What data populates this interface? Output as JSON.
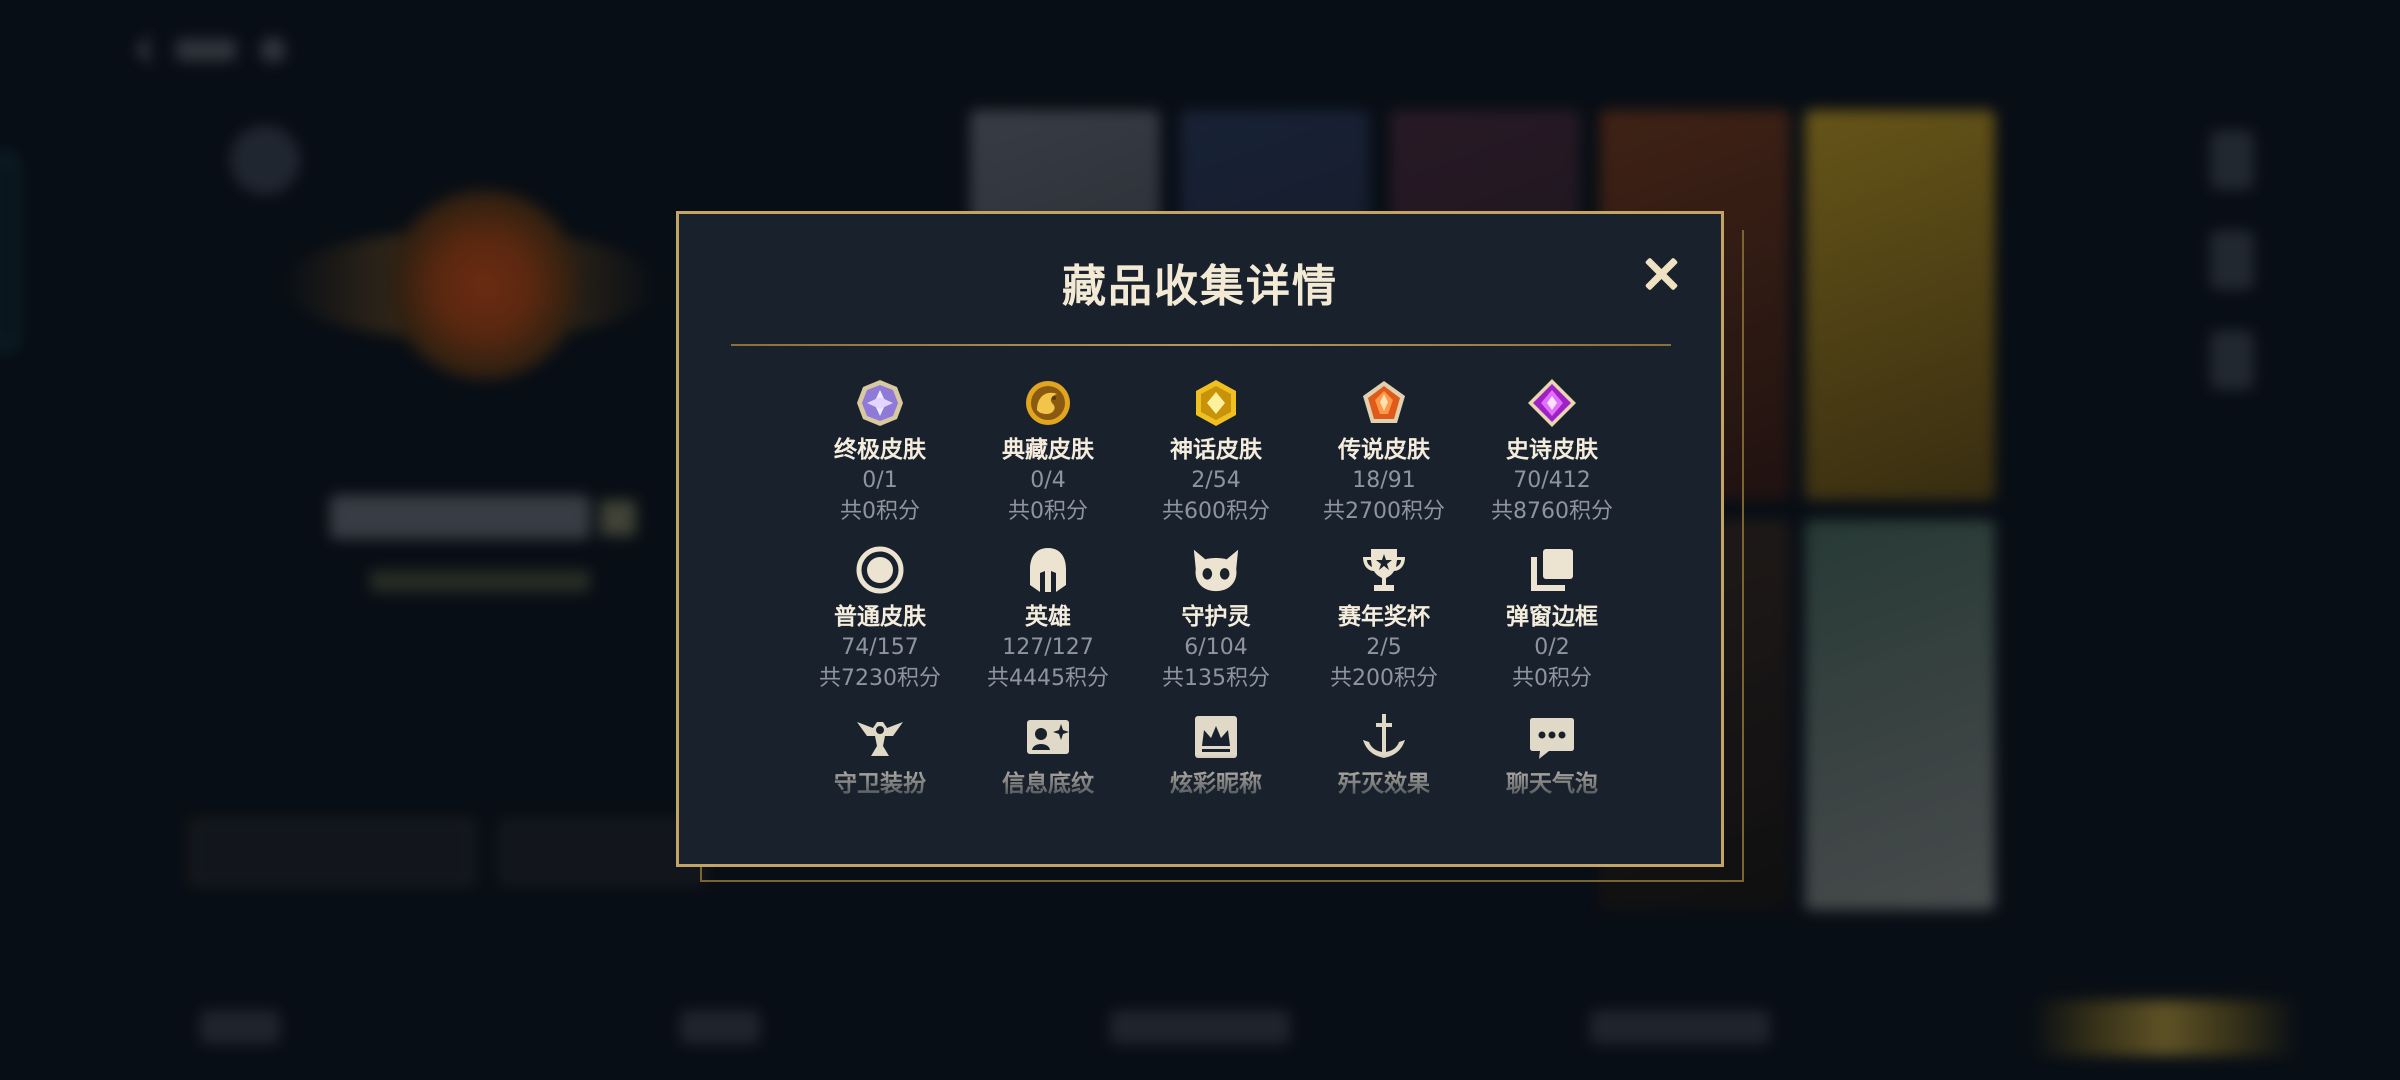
{
  "modal": {
    "title": "藏品收集详情"
  },
  "items": [
    {
      "label": "终极皮肤",
      "count": "0/1",
      "points": "共0积分",
      "icon": "ultimate-gem-icon"
    },
    {
      "label": "典藏皮肤",
      "count": "0/4",
      "points": "共0积分",
      "icon": "collector-dragon-icon"
    },
    {
      "label": "神话皮肤",
      "count": "2/54",
      "points": "共600积分",
      "icon": "mythic-gem-icon"
    },
    {
      "label": "传说皮肤",
      "count": "18/91",
      "points": "共2700积分",
      "icon": "legendary-gem-icon"
    },
    {
      "label": "史诗皮肤",
      "count": "70/412",
      "points": "共8760积分",
      "icon": "epic-gem-icon"
    },
    {
      "label": "普通皮肤",
      "count": "74/157",
      "points": "共7230积分",
      "icon": "common-ring-icon"
    },
    {
      "label": "英雄",
      "count": "127/127",
      "points": "共4445积分",
      "icon": "helmet-icon"
    },
    {
      "label": "守护灵",
      "count": "6/104",
      "points": "共135积分",
      "icon": "guardian-pet-icon"
    },
    {
      "label": "赛年奖杯",
      "count": "2/5",
      "points": "共200积分",
      "icon": "trophy-icon"
    },
    {
      "label": "弹窗边框",
      "count": "0/2",
      "points": "共0积分",
      "icon": "frame-icon"
    },
    {
      "label": "守卫装扮",
      "icon": "ward-icon"
    },
    {
      "label": "信息底纹",
      "icon": "card-background-icon"
    },
    {
      "label": "炫彩昵称",
      "icon": "crown-nickname-icon"
    },
    {
      "label": "歼灭效果",
      "icon": "anchor-effect-icon"
    },
    {
      "label": "聊天气泡",
      "icon": "chat-bubble-icon"
    }
  ],
  "colors": {
    "modal_bg": "#19212c",
    "modal_border": "#c4a466",
    "title": "#f3ead6",
    "label": "#f4ecdc",
    "subtext": "#8e959e"
  }
}
